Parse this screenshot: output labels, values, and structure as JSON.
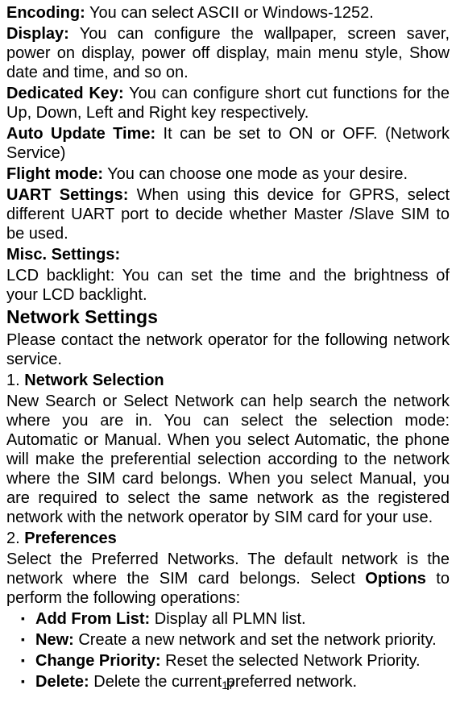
{
  "items": [
    {
      "label": "Encoding:",
      "text": " You can select ASCII or Windows-1252."
    },
    {
      "label": "Display:",
      "text": " You can configure the wallpaper, screen saver, power on display, power off display, main menu style, Show date and time, and so on."
    },
    {
      "label": "Dedicated Key:",
      "text": " You can configure short cut functions for the Up, Down, Left and Right key respectively."
    },
    {
      "label": "Auto Update Time:",
      "text": " It can be set to ON or OFF. (Network Service)"
    },
    {
      "label": "Flight mode:",
      "text": " You can choose one mode as your desire."
    },
    {
      "label": "UART Settings:",
      "text": " When using this device for GPRS, select different UART port to decide whether Master /Slave SIM to be used."
    },
    {
      "label": "Misc. Settings:",
      "text": ""
    }
  ],
  "misc_text": "LCD backlight: You can set the time and the brightness of your LCD backlight.",
  "heading": "Network Settings",
  "intro": "Please contact the network operator for the following network service.",
  "section1": {
    "num": "1.",
    "title": " Network Selection",
    "body": "New Search or Select Network can help search the network where you are in. You can select the selection mode: Automatic or Manual. When you select Automatic, the phone will make the preferential selection according to the network where the SIM card belongs. When you select Manual, you are required to select the same network as the registered network with the network operator by SIM card for your use."
  },
  "section2": {
    "num": "2.",
    "title": " Preferences",
    "body_pre": "Select the Preferred Networks. The default network is the network where the SIM card belongs. Select ",
    "body_bold": "Options",
    "body_post": " to perform the following operations:"
  },
  "bullets": [
    {
      "label": "Add From List:",
      "text": " Display all PLMN list."
    },
    {
      "label": "New:",
      "text": " Create a new network and set the network priority."
    },
    {
      "label": "Change Priority:",
      "text": " Reset the selected Network Priority."
    },
    {
      "label": "Delete:",
      "text": " Delete the current preferred network."
    }
  ],
  "page_number": "17"
}
